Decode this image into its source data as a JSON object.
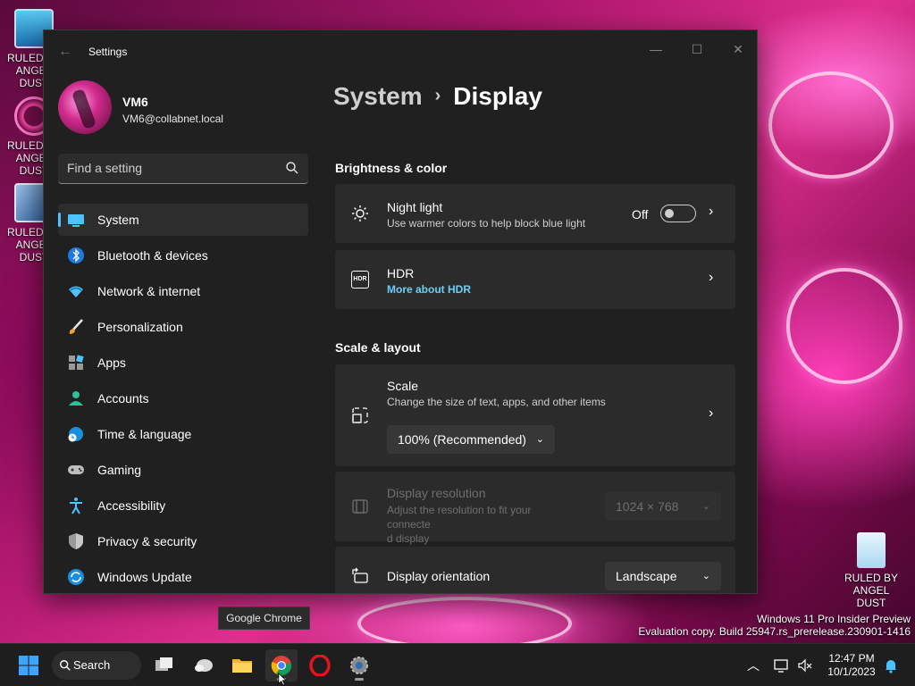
{
  "desktop": {
    "icons": [
      {
        "label": "RULED BY ANGEL DUST",
        "icon": "monitor-icon"
      },
      {
        "label": "RULED BY ANGEL DUST",
        "icon": "shortcut-icon"
      },
      {
        "label": "RULED BY ANGEL DUST",
        "icon": "virtualbox-icon"
      }
    ],
    "recycle_bin": {
      "label": "RULED BY ANGEL DUST",
      "icon": "recycle-bin-icon"
    },
    "watermark": {
      "line1": "Windows 11 Pro Insider Preview",
      "line2": "Evaluation copy. Build 25947.rs_prerelease.230901-1416"
    },
    "tooltip": "Google Chrome"
  },
  "window": {
    "title": "Settings",
    "controls": {
      "minimize": "—",
      "maximize": "☐",
      "close": "✕"
    },
    "profile": {
      "name": "VM6",
      "email": "VM6@collabnet.local"
    },
    "search": {
      "placeholder": "Find a setting"
    },
    "nav": [
      {
        "label": "System",
        "icon": "system-icon",
        "active": true
      },
      {
        "label": "Bluetooth & devices",
        "icon": "bluetooth-icon"
      },
      {
        "label": "Network & internet",
        "icon": "wifi-icon"
      },
      {
        "label": "Personalization",
        "icon": "brush-icon"
      },
      {
        "label": "Apps",
        "icon": "apps-icon"
      },
      {
        "label": "Accounts",
        "icon": "account-icon"
      },
      {
        "label": "Time & language",
        "icon": "globe-clock-icon"
      },
      {
        "label": "Gaming",
        "icon": "gamepad-icon"
      },
      {
        "label": "Accessibility",
        "icon": "accessibility-icon"
      },
      {
        "label": "Privacy & security",
        "icon": "shield-icon"
      },
      {
        "label": "Windows Update",
        "icon": "update-icon"
      }
    ],
    "breadcrumb": {
      "parent": "System",
      "separator": "›",
      "current": "Display"
    },
    "sections": {
      "brightness": "Brightness & color",
      "scale_layout": "Scale & layout"
    },
    "night_light": {
      "title": "Night light",
      "subtitle": "Use warmer colors to help block blue light",
      "state": "Off"
    },
    "hdr": {
      "title": "HDR",
      "link": "More about HDR",
      "badge": "HDR"
    },
    "scale": {
      "title": "Scale",
      "subtitle": "Change the size of text, apps, and other items",
      "value": "100% (Recommended)"
    },
    "resolution": {
      "title": "Display resolution",
      "subtitle_line1": "Adjust the resolution to fit your connecte",
      "subtitle_line2": "d display",
      "value": "1024 × 768"
    },
    "orientation": {
      "title": "Display orientation",
      "value": "Landscape"
    }
  },
  "taskbar": {
    "search_label": "Search",
    "apps": [
      "start-icon",
      "task-view-icon",
      "widgets-icon",
      "file-explorer-icon",
      "chrome-icon",
      "opera-icon",
      "settings-icon"
    ],
    "clock": {
      "time": "12:47 PM",
      "date": "10/1/2023"
    },
    "accent": "#4cc2ff"
  }
}
